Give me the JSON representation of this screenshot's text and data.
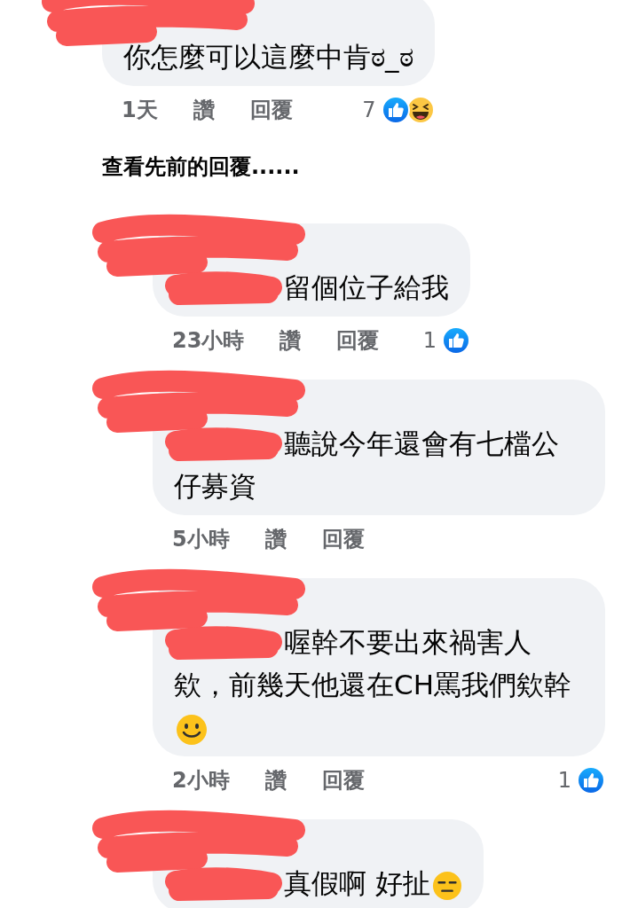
{
  "top_comment": {
    "redacted": true,
    "text": "你怎麼可以這麼中肯ಠ_ಠ",
    "time": "1天",
    "like_label": "讚",
    "reply_label": "回覆",
    "reaction_count": "7",
    "reactions": [
      {
        "kind": "like"
      },
      {
        "kind": "haha"
      }
    ]
  },
  "view_previous_replies": "查看先前的回覆......",
  "replies": [
    {
      "redacted": true,
      "mention_redacted": true,
      "text": "留個位子給我",
      "time": "23小時",
      "like_label": "讚",
      "reply_label": "回覆",
      "reaction_count": "1",
      "reactions": [
        {
          "kind": "like"
        }
      ]
    },
    {
      "redacted": true,
      "mention_redacted": true,
      "text": "聽說今年還會有七檔公仔募資",
      "time": "5小時",
      "like_label": "讚",
      "reply_label": "回覆"
    },
    {
      "redacted": true,
      "mention_redacted": true,
      "text": "喔幹不要出來禍害人欸，前幾天他還在CH罵我們欸幹",
      "trailing_emoji": {
        "kind": "smile"
      },
      "time": "2小時",
      "like_label": "讚",
      "reply_label": "回覆",
      "reaction_count": "1",
      "reactions": [
        {
          "kind": "like"
        }
      ]
    },
    {
      "redacted": true,
      "mention_redacted": true,
      "text": "真假啊 好扯",
      "trailing_emoji": {
        "kind": "expressionless"
      }
    }
  ]
}
